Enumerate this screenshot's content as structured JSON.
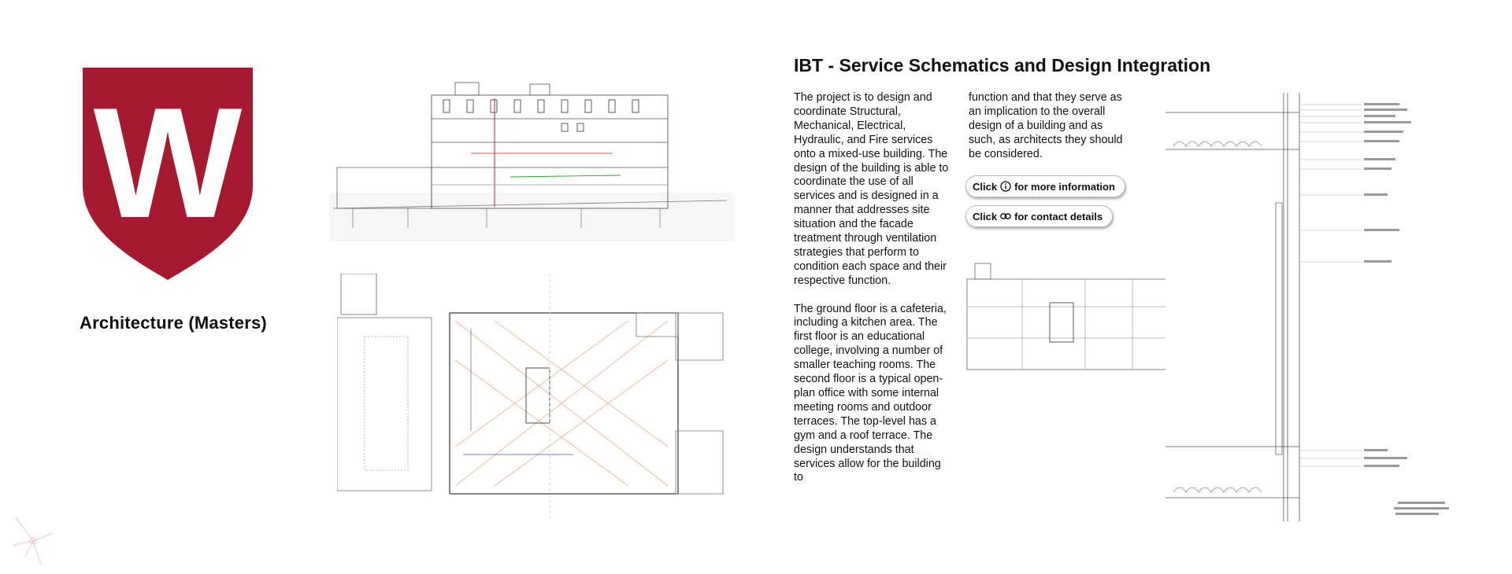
{
  "program": {
    "title": "Architecture (Masters)",
    "logo_letter": "W",
    "brand_color": "#A6192E"
  },
  "heading": "IBT - Service Schematics and Design Integration",
  "description": {
    "paragraph_1": "The project is to design and coordinate Structural, Mechanical, Electrical, Hydraulic, and Fire services onto a mixed-use building. The design of the building is able to coordinate the use of all services and is designed in a manner that addresses site situation and the facade treatment through ventilation strategies that perform to condition each space and their respective function.",
    "paragraph_2": "The ground floor is a cafeteria, including a kitchen area. The first floor is an educational college, involving a number of smaller teaching rooms. The second floor is a typical open-plan office with some internal meeting rooms and outdoor terraces. The top-level has a gym and a roof terrace. The design understands that services allow for the building to",
    "paragraph_3": "function and that they serve as an implication to the overall design of a building and as such, as architects they should be considered."
  },
  "buttons": {
    "info": {
      "prefix": "Click",
      "suffix": "for more information",
      "icon": "info-icon"
    },
    "contact": {
      "prefix": "Click",
      "suffix": "for contact details",
      "icon": "link-icon"
    }
  }
}
